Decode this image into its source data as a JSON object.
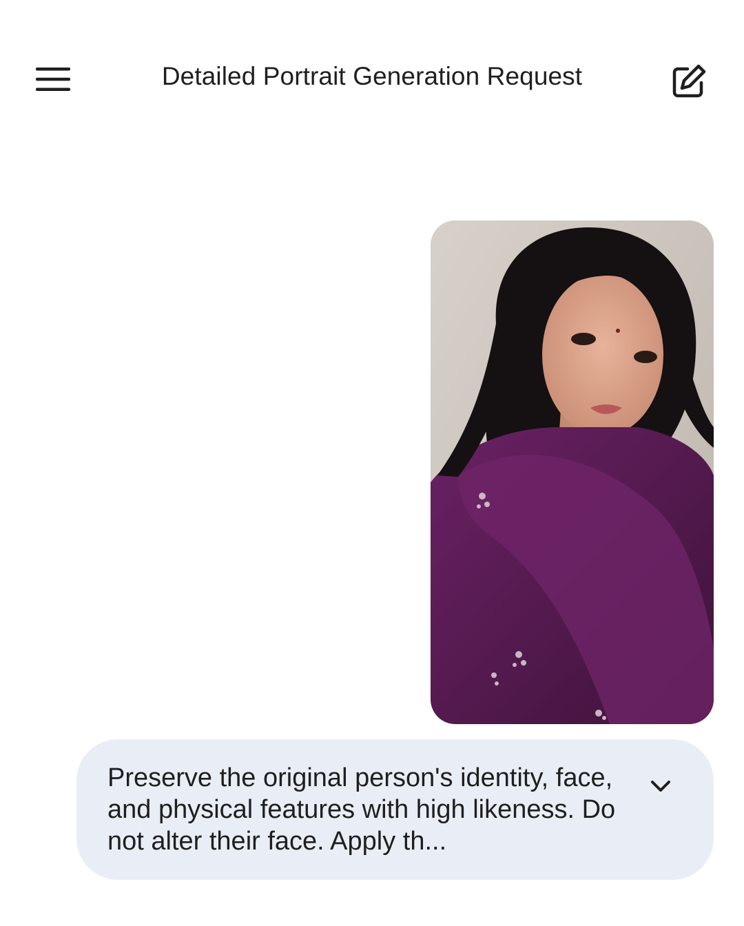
{
  "header": {
    "title": "Detailed Portrait Generation Request",
    "menu_icon": "menu-icon",
    "edit_icon": "new-chat-edit-icon"
  },
  "conversation": {
    "attachment": {
      "type": "image",
      "subject": "portrait-photo"
    },
    "prompt": {
      "text": "Preserve the original person's identity, face, and physical features with high likeness. Do not alter their face. Apply th...",
      "expand_icon": "chevron-down-icon"
    }
  },
  "colors": {
    "background": "#ffffff",
    "bubble": "#e9eef6",
    "text": "#1f1f1f",
    "outfit": "#5b1a55",
    "hair": "#141012",
    "wall": "#cfc8c0"
  }
}
